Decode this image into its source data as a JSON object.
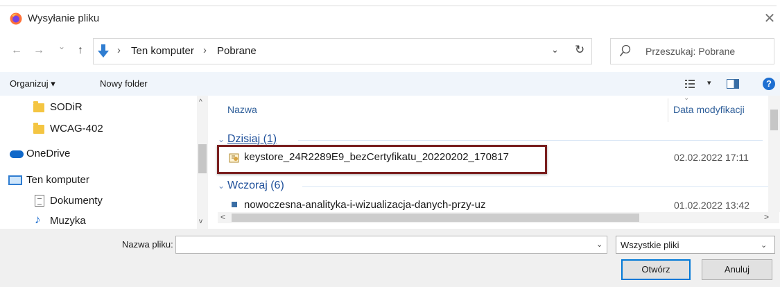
{
  "window": {
    "title": "Wysyłanie pliku",
    "close_glyph": "✕"
  },
  "address": {
    "back_glyph": "←",
    "forward_glyph": "→",
    "recent_glyph": "⌄",
    "up_glyph": "↑",
    "crumbs": [
      "Ten komputer",
      "Pobrane"
    ],
    "crumb_sep": "›",
    "dropdown_glyph": "⌄",
    "refresh_glyph": "↻"
  },
  "search": {
    "placeholder": "Przeszukaj: Pobrane"
  },
  "toolbar": {
    "organize_label": "Organizuj ▾",
    "new_folder_label": "Nowy folder",
    "view_dropdown": "▾",
    "help_label": "?"
  },
  "nav": {
    "items": [
      {
        "label": "SODiR",
        "icon": "folder-icon"
      },
      {
        "label": "WCAG-402",
        "icon": "folder-icon"
      },
      {
        "label": "OneDrive",
        "icon": "cloud-icon"
      },
      {
        "label": "Ten komputer",
        "icon": "computer-icon"
      },
      {
        "label": "Dokumenty",
        "icon": "documents-icon"
      },
      {
        "label": "Muzyka",
        "icon": "music-icon"
      }
    ],
    "scroll_up": "^",
    "scroll_down": "v"
  },
  "files": {
    "columns": {
      "name": "Nazwa",
      "date": "Data modyfikacji"
    },
    "groups": [
      {
        "label": "Dzisiaj (1)",
        "rows": [
          {
            "name": "keystore_24R2289E9_bezCertyfikatu_20220202_170817",
            "date": "02.02.2022 17:11",
            "icon": "certificate-file-icon"
          }
        ]
      },
      {
        "label": "Wczoraj (6)",
        "rows": [
          {
            "name": "nowoczesna-analityka-i-wizualizacja-danych-przy-uz",
            "date": "01.02.2022 13:42",
            "icon": "file-icon"
          }
        ]
      }
    ],
    "group_chevron": "⌄",
    "hscroll_left": "<",
    "hscroll_right": ">"
  },
  "bottom": {
    "filename_label": "Nazwa pliku:",
    "filename_value": "",
    "filename_dropdown": "⌄",
    "filetype_selected": "Wszystkie pliki",
    "filetype_dropdown": "⌄",
    "open_label": "Otwórz",
    "cancel_label": "Anuluj"
  },
  "colors": {
    "accent": "#0078d7",
    "group_header": "#1e4f9a",
    "highlight_border": "#7a1f1f",
    "folder": "#f4c542"
  }
}
